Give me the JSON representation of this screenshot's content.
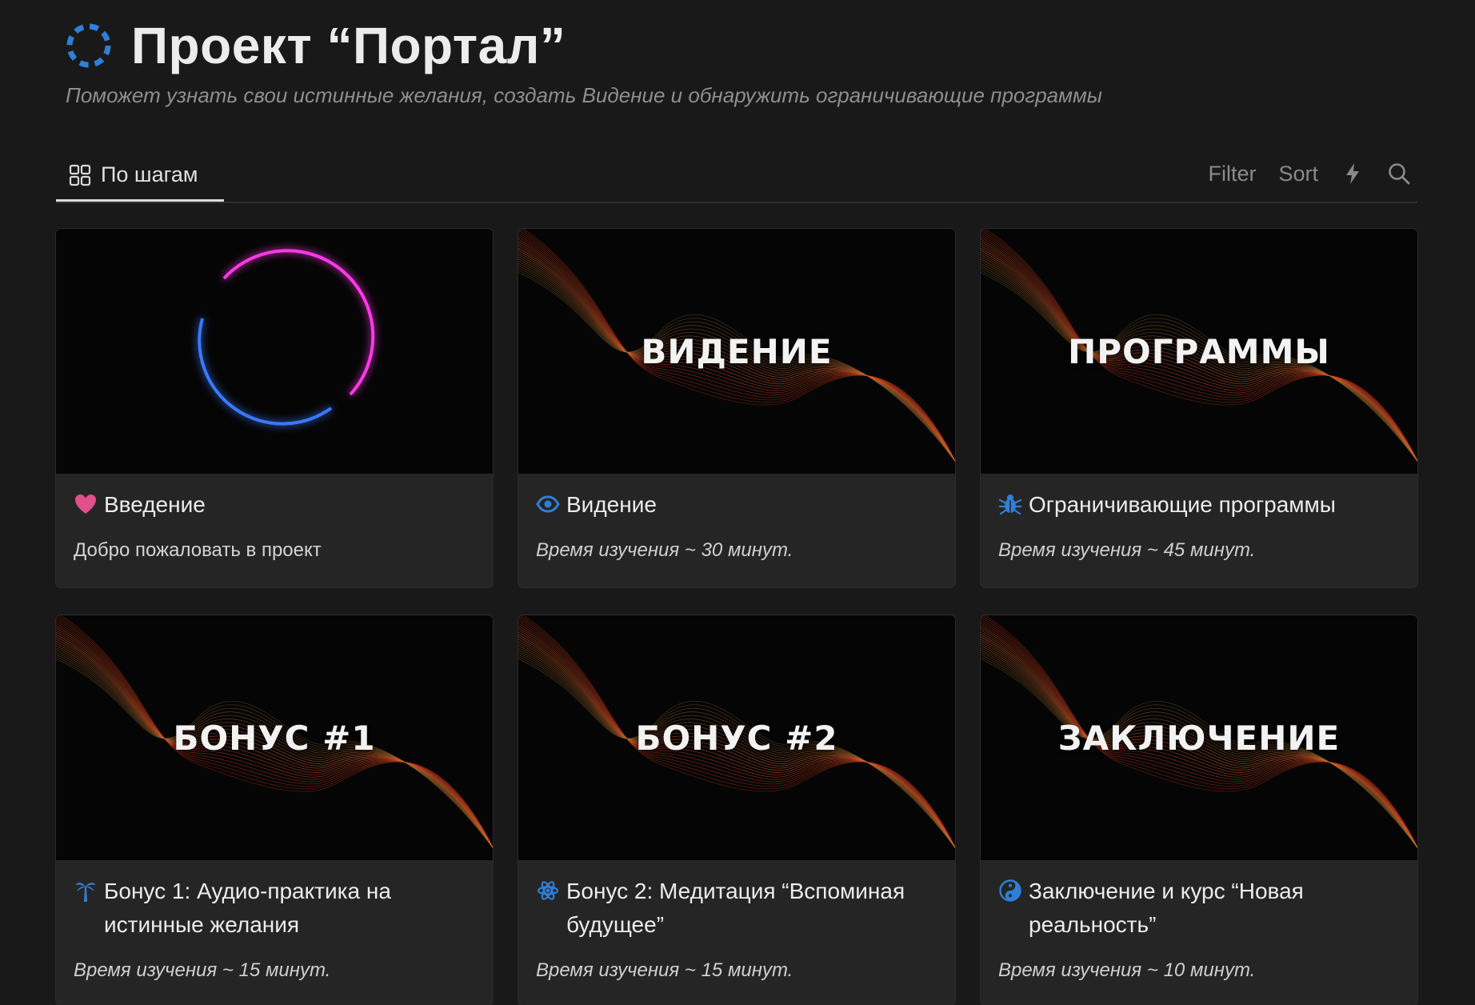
{
  "header": {
    "title": "Проект “Портал”",
    "subtitle": "Поможет узнать свои истинные желания, создать Видение и обнаружить ограничивающие программы",
    "icon": "dashed-circle-icon",
    "icon_color": "#2f7fd6"
  },
  "tabs": [
    {
      "label": "По шагам",
      "icon": "gallery-grid-icon",
      "active": true
    }
  ],
  "toolbar": {
    "filter_label": "Filter",
    "sort_label": "Sort",
    "automation_icon": "lightning-icon",
    "search_icon": "search-icon"
  },
  "cards": [
    {
      "cover_text": "",
      "cover_style": "neon-ring",
      "icon": "heart-icon",
      "icon_color": "#e0508a",
      "title": "Введение",
      "description": "Добро пожаловать в проект",
      "italic": false
    },
    {
      "cover_text": "ВИДЕНИЕ",
      "cover_style": "waves",
      "icon": "eye-icon",
      "icon_color": "#2f7fd6",
      "title": "Видение",
      "description": "Время изучения ~ 30 минут.",
      "italic": true
    },
    {
      "cover_text": "ПРОГРАММЫ",
      "cover_style": "waves",
      "icon": "bug-icon",
      "icon_color": "#2f7fd6",
      "title": "Ограничивающие программы",
      "description": "Время изучения ~ 45 минут.",
      "italic": true
    },
    {
      "cover_text": "БОНУС #1",
      "cover_style": "waves",
      "icon": "palm-tree-icon",
      "icon_color": "#2f7fd6",
      "title": "Бонус 1: Аудио-практика на истинные желания",
      "description": "Время изучения ~ 15 минут.",
      "italic": true
    },
    {
      "cover_text": "БОНУС #2",
      "cover_style": "waves",
      "icon": "atom-icon",
      "icon_color": "#2f7fd6",
      "title": "Бонус 2: Медитация “Вспоминая будущее”",
      "description": "Время изучения ~ 15 минут.",
      "italic": true
    },
    {
      "cover_text": "ЗАКЛЮЧЕНИЕ",
      "cover_style": "waves",
      "icon": "yin-yang-icon",
      "icon_color": "#2f7fd6",
      "title": "Заключение и курс “Новая реальность”",
      "description": "Время изучения ~ 10 минут.",
      "italic": true
    }
  ]
}
